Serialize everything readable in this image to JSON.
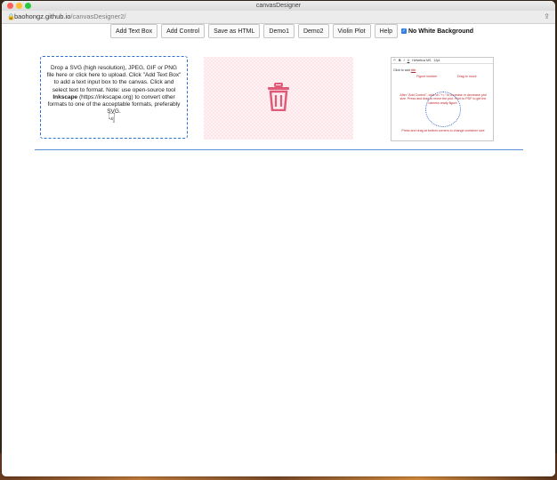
{
  "window": {
    "title": "canvasDesigner"
  },
  "address": {
    "host": "baohongz.github.io",
    "path": "/canvasDesigner2/"
  },
  "toolbar": {
    "buttons": [
      "Add Text Box",
      "Add Control",
      "Save as HTML",
      "Demo1",
      "Demo2",
      "Violin Plot",
      "Help"
    ],
    "checkbox_label": "No White Background",
    "checkbox_checked": true
  },
  "dropzone": {
    "text1": "Drop a SVG (high resolution), JPEG, GIF or PNG file here or click here to upload. Click \"Add Text Box\" to add a text input box to the canvas. Click and select text to format. Note: use open-source tool ",
    "bold": "Inkscape",
    "text2": " (https://inkscape.org) to convert other formats to one of the acceptable formats, preferably SVG."
  },
  "preview": {
    "font": "Helvetica MS",
    "size": "12pt",
    "click_to_add": "Click to add",
    "title_word": "title",
    "figure_number": "Figure number",
    "drag_to_move": "Drag to move",
    "after_note": "After \"Add Control\", click on \"+/-\" to increase or decrease plot size. Press and drag to move the plot. Print to PDF to get the camera-ready figure.",
    "bottom_note": "Press and drag at bottom corners to change container size"
  },
  "colors": {
    "accent": "#2f6fd0",
    "trash": "#e05a78",
    "annotation": "#c0272d"
  }
}
